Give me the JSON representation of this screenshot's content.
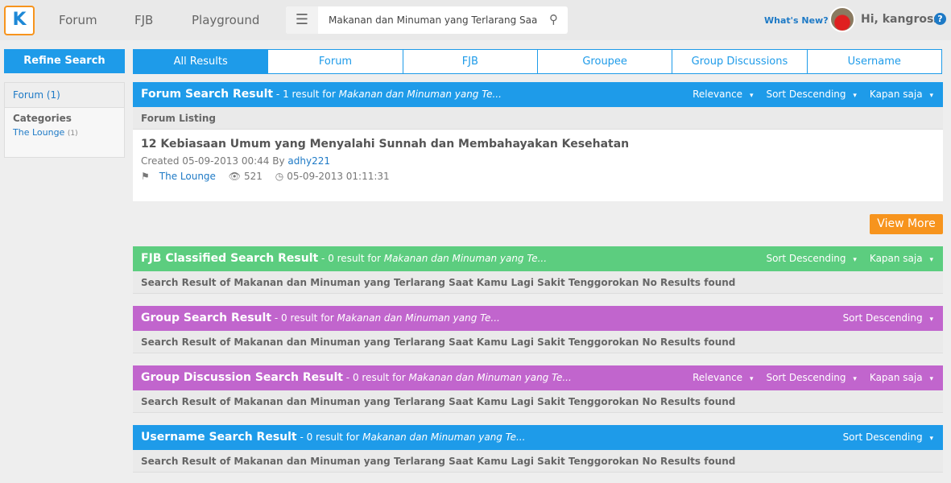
{
  "header": {
    "logo": "K",
    "nav": [
      "Forum",
      "FJB",
      "Playground"
    ],
    "search_value": "Makanan dan Minuman yang Terlarang Saa",
    "whats_new": "What's New?",
    "greeting": "Hi, kangrossi",
    "help": "?"
  },
  "sidebar": {
    "refine": "Refine Search",
    "forum": "Forum (1)",
    "categories": "Categories",
    "category": "The Lounge",
    "category_count": "(1)"
  },
  "tabs": [
    "All Results",
    "Forum",
    "FJB",
    "Groupee",
    "Group Discussions",
    "Username"
  ],
  "colors": {
    "blue": "#1e9be9",
    "green": "#5ccd7f",
    "purple": "#c165cd",
    "orange": "#f7941d"
  },
  "forum": {
    "title": "Forum Search Result",
    "summary": "- 1 result for ",
    "query": "Makanan dan Minuman yang Te...",
    "sorts": [
      "Relevance",
      "Sort Descending",
      "Kapan saja"
    ],
    "listing": "Forum Listing",
    "item": {
      "title": "12 Kebiasaan Umum yang Menyalahi Sunnah dan Membahayakan Kesehatan",
      "created": "Created 05-09-2013 00:44 By ",
      "author": "adhy221",
      "category": "The Lounge",
      "views": "521",
      "last": "05-09-2013 01:11:31"
    },
    "view_more": "View More"
  },
  "fjb": {
    "title": "FJB Classified Search Result",
    "summary": "- 0 result for ",
    "query": "Makanan dan Minuman yang Te...",
    "sorts": [
      "Sort Descending",
      "Kapan saja"
    ],
    "empty": "Search Result of Makanan dan Minuman yang Terlarang Saat Kamu Lagi Sakit Tenggorokan No Results found"
  },
  "group": {
    "title": "Group Search Result",
    "summary": "- 0 result for ",
    "query": "Makanan dan Minuman yang Te...",
    "sorts": [
      "Sort Descending"
    ],
    "empty": "Search Result of Makanan dan Minuman yang Terlarang Saat Kamu Lagi Sakit Tenggorokan No Results found"
  },
  "gd": {
    "title": "Group Discussion Search Result",
    "summary": "- 0 result for ",
    "query": "Makanan dan Minuman yang Te...",
    "sorts": [
      "Relevance",
      "Sort Descending",
      "Kapan saja"
    ],
    "empty": "Search Result of Makanan dan Minuman yang Terlarang Saat Kamu Lagi Sakit Tenggorokan No Results found"
  },
  "user": {
    "title": "Username Search Result",
    "summary": "- 0 result for ",
    "query": "Makanan dan Minuman yang Te...",
    "sorts": [
      "Sort Descending"
    ],
    "empty": "Search Result of Makanan dan Minuman yang Terlarang Saat Kamu Lagi Sakit Tenggorokan No Results found"
  }
}
